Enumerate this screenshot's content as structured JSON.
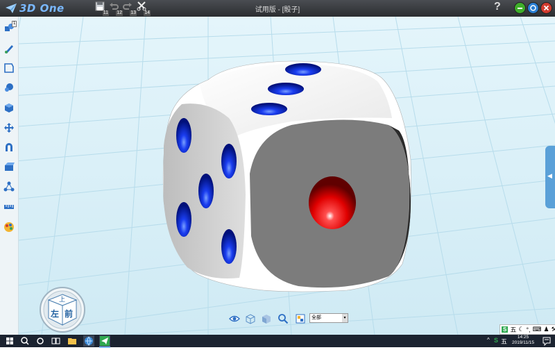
{
  "app": {
    "brand": "3D One",
    "document_title": "试用版 - [骰子]",
    "help_label": "?"
  },
  "toolbar": {
    "save": {
      "icon": "save-icon",
      "key": "11"
    },
    "undo": {
      "icon": "undo-icon",
      "key": "12"
    },
    "redo": {
      "icon": "redo-icon",
      "key": "13"
    },
    "cut": {
      "icon": "cut-icon",
      "key": "14"
    }
  },
  "window_buttons": [
    {
      "name": "minimize",
      "color": "#3fae2a"
    },
    {
      "name": "restore",
      "color": "#2a7fd4"
    },
    {
      "name": "close",
      "color": "#d23b2f"
    }
  ],
  "left_toolbar": {
    "badge": "1",
    "tools": [
      "basic-shapes-icon",
      "sketch-icon",
      "sketch-edit-icon",
      "special-features-icon",
      "feature-modeling-icon",
      "transform-icon",
      "adsorb-icon",
      "combine-icon",
      "array-icon",
      "measure-icon",
      "material-icon"
    ]
  },
  "nav_cube": {
    "top_label": "上",
    "left_label": "左",
    "front_label": "前"
  },
  "bottom_toolbar": {
    "tools": [
      "view-icon",
      "wireframe-icon",
      "shaded-icon",
      "zoom-icon",
      "filter-icon"
    ],
    "filter_value": "全部"
  },
  "ime": {
    "logo": "S",
    "mode": "五"
  },
  "taskbar": {
    "time": "14:25",
    "date": "2019/11/15",
    "tray_logo": "S",
    "tray_ime": "五"
  },
  "colors": {
    "accent": "#5aa0d8",
    "pip_blue": "#0a1fd8",
    "pip_red": "#e01010"
  }
}
